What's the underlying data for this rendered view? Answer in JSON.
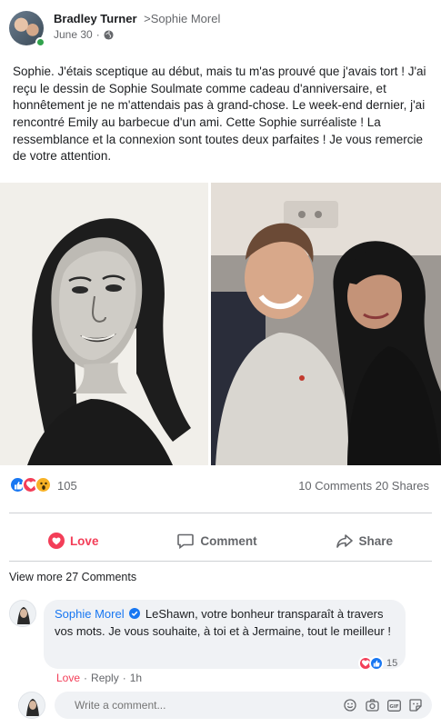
{
  "post": {
    "author": "Bradley Turner",
    "arrow": ">",
    "target": "Sophie Morel",
    "date": "June 30",
    "separator": "·",
    "text": "Sophie. J'étais sceptique au début, mais tu m'as prouvé que j'avais tort ! J'ai reçu le dessin de Sophie Soulmate comme cadeau d'anniversaire, et honnêtement je ne m'attendais pas à grand-chose. Le week-end dernier, j'ai rencontré Emily au barbecue d'un ami. Cette Sophie surréaliste ! La ressemblance et la connexion sont toutes deux parfaites ! Je vous remercie de votre attention."
  },
  "stats": {
    "reaction_count": "105",
    "comments_shares": "10 Comments 20 Shares"
  },
  "actions": {
    "love": "Love",
    "comment": "Comment",
    "share": "Share"
  },
  "view_more": "View more 27 Comments",
  "comment": {
    "author": "Sophie Morel",
    "text": "LeShawn, votre bonheur transparaît à travers vos mots. Je vous souhaite, à toi et à Jermaine, tout le meilleur !",
    "reaction_count": "15",
    "love": "Love",
    "dot": "·",
    "reply": "Reply",
    "time": "1h"
  },
  "compose": {
    "placeholder": "Write a comment..."
  },
  "colors": {
    "accent_blue": "#1877f2",
    "love_red": "#f33e58",
    "muted_text": "#65676b",
    "bubble_bg": "#f0f2f5",
    "online_green": "#31a24c"
  },
  "icons": [
    "globe-icon",
    "like-icon",
    "love-icon",
    "wow-icon",
    "heart-outline-icon",
    "comment-icon",
    "share-icon",
    "verified-icon",
    "emoji-icon",
    "camera-icon",
    "gif-icon",
    "sticker-icon"
  ]
}
